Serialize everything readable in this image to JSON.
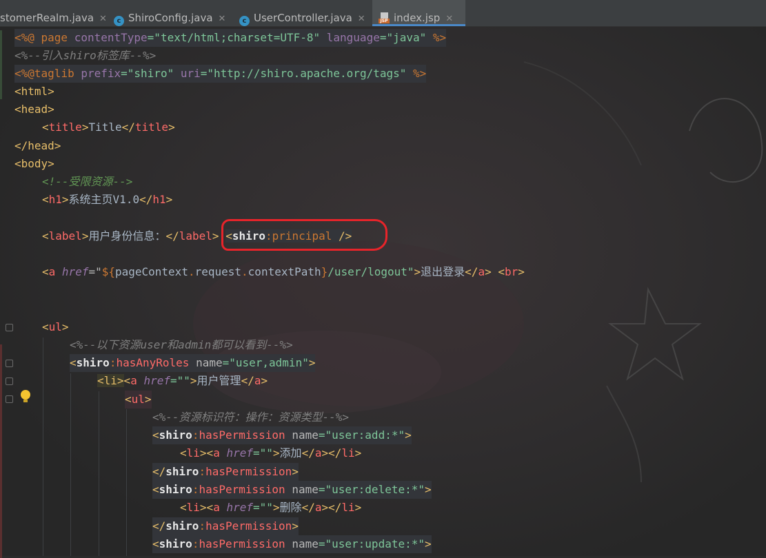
{
  "tabs": [
    {
      "label": "stomerRealm.java",
      "icon": "none",
      "active": false
    },
    {
      "label": "ShiroConfig.java",
      "icon": "class-icon",
      "active": false
    },
    {
      "label": "UserController.java",
      "icon": "class-icon",
      "active": false
    },
    {
      "label": "index.jsp",
      "icon": "jsp-icon",
      "active": true
    }
  ],
  "tab_close_glyph": "✕",
  "icon_letter": "c",
  "jsp_icon_label": "JSP",
  "code": {
    "l1": [
      "<%@ ",
      "page",
      " ",
      "contentType",
      "=\"text/html;charset=UTF-8\" ",
      "language",
      "=\"java\"",
      " %>"
    ],
    "l2": "<%--引入shiro标签库--%>",
    "l3": [
      "<%@",
      "taglib",
      " ",
      "prefix",
      "=\"shiro\" ",
      "uri",
      "=\"http://shiro.apache.org/tags\"",
      " %>"
    ],
    "l4": "html",
    "l5": "head",
    "l6": [
      "title",
      "Title",
      "title"
    ],
    "l7": "head",
    "l8": "body",
    "l9": "<!--受限资源-->",
    "l10": [
      "h1",
      "系统主页V1.0",
      "h1"
    ],
    "l11": [
      "label",
      "用户身份信息：",
      "label",
      "shiro",
      "principal",
      " />"
    ],
    "l12": [
      "a",
      "href",
      "${",
      "pageContext",
      "request",
      "contextPath",
      "}",
      "/user/logout",
      "退出登录",
      "a",
      "br"
    ],
    "l13": "ul",
    "l14": "<%--以下资源user和admin都可以看到--%>",
    "l15": [
      "shiro",
      "hasAnyRoles",
      "name",
      "\"user,admin\""
    ],
    "l16": [
      "li",
      "a",
      "href",
      "\"\"",
      "用户管理",
      "a"
    ],
    "l17": "ul",
    "l18": "<%--资源标识符：操作：资源类型--%>",
    "l19": [
      "shiro",
      "hasPermission",
      "name",
      "\"user:add:*\""
    ],
    "l20": [
      "li",
      "a",
      "href",
      "\"\"",
      "添加",
      "a",
      "li"
    ],
    "l21": [
      "shiro",
      "hasPermission"
    ],
    "l22": [
      "shiro",
      "hasPermission",
      "name",
      "\"user:delete:*\""
    ],
    "l23": [
      "li",
      "a",
      "href",
      "\"\"",
      "删除",
      "a",
      "li"
    ],
    "l24": [
      "shiro",
      "hasPermission"
    ],
    "l25": [
      "shiro",
      "hasPermission",
      "name",
      "\"user:update:*\""
    ]
  },
  "colors": {
    "accent": "#4a88c7",
    "annotation": "#e8242a",
    "background": "#2b2b2b"
  }
}
